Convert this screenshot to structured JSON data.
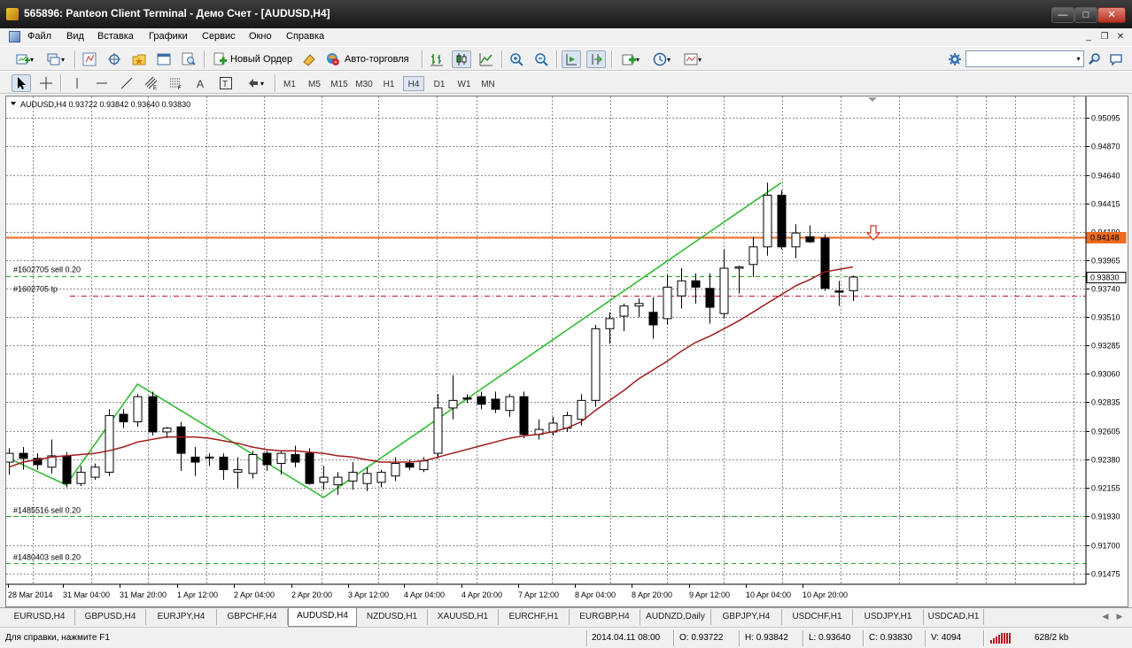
{
  "window": {
    "title": "565896: Panteon Client Terminal - Демо Счет - [AUDUSD,H4]",
    "minimize": "0",
    "maximize": "1",
    "close": "r"
  },
  "menu": {
    "items": [
      "Файл",
      "Вид",
      "Вставка",
      "Графики",
      "Сервис",
      "Окно",
      "Справка"
    ],
    "mdi": [
      "_",
      "❐",
      "✕"
    ]
  },
  "toolbar": {
    "new_order": "Новый Ордер",
    "auto_trading": "Авто-торговля",
    "timeframes": [
      "M1",
      "M5",
      "M15",
      "M30",
      "H1",
      "H4",
      "D1",
      "W1",
      "MN"
    ],
    "active_timeframe": "H4"
  },
  "chart": {
    "header": "AUDUSD,H4  0.93722 0.93842 0.93640 0.93830",
    "colors": {
      "bull_fill": "#ffffff",
      "bear_fill": "#000000",
      "ma": "#a01c1c",
      "zigzag": "#33bb33",
      "price_line": "#ee6a1f",
      "order_line": "#22a822",
      "tp_line": "#c8102e"
    },
    "order_labels": {
      "sell1": "#1602705 sell 0.20",
      "tp1": "#1602705 tp",
      "sell2": "#1485516 sell 0.20",
      "sell3": "#1480403 sell 0.20"
    },
    "price_tags": {
      "current": "0.94148",
      "bid": "0.93830"
    }
  },
  "chart_data": {
    "type": "candlestick",
    "symbol": "AUDUSD",
    "timeframe": "H4",
    "y_ticks": [
      "0.95095",
      "0.94870",
      "0.94640",
      "0.94415",
      "0.94190",
      "0.93965",
      "0.93740",
      "0.93510",
      "0.93285",
      "0.93060",
      "0.92835",
      "0.92605",
      "0.92380",
      "0.92155",
      "0.91930",
      "0.91700",
      "0.91475"
    ],
    "x_ticks": [
      "28 Mar 2014",
      "31 Mar 04:00",
      "31 Mar 20:00",
      "1 Apr 12:00",
      "2 Apr 04:00",
      "2 Apr 20:00",
      "3 Apr 12:00",
      "4 Apr 04:00",
      "4 Apr 20:00",
      "7 Apr 12:00",
      "8 Apr 04:00",
      "8 Apr 20:00",
      "9 Apr 12:00",
      "10 Apr 04:00",
      "10 Apr 20:00"
    ],
    "ylim": [
      0.9139,
      0.9525
    ],
    "candles": [
      [
        0.9236,
        0.9247,
        0.9226,
        0.9243
      ],
      [
        0.9243,
        0.9248,
        0.923,
        0.9239
      ],
      [
        0.9239,
        0.9243,
        0.923,
        0.9234
      ],
      [
        0.9232,
        0.9254,
        0.9227,
        0.9241
      ],
      [
        0.9241,
        0.9244,
        0.9216,
        0.9219
      ],
      [
        0.9219,
        0.9233,
        0.9217,
        0.9228
      ],
      [
        0.9224,
        0.9235,
        0.9222,
        0.9232
      ],
      [
        0.9228,
        0.9278,
        0.9225,
        0.9273
      ],
      [
        0.9274,
        0.9278,
        0.9263,
        0.9268
      ],
      [
        0.9268,
        0.929,
        0.9264,
        0.9288
      ],
      [
        0.9288,
        0.9292,
        0.9257,
        0.926
      ],
      [
        0.926,
        0.9264,
        0.9255,
        0.9263
      ],
      [
        0.9264,
        0.9268,
        0.9229,
        0.9243
      ],
      [
        0.924,
        0.9248,
        0.9225,
        0.9236
      ],
      [
        0.924,
        0.9243,
        0.9233,
        0.924
      ],
      [
        0.924,
        0.9243,
        0.9222,
        0.923
      ],
      [
        0.9228,
        0.924,
        0.9215,
        0.923
      ],
      [
        0.9227,
        0.9245,
        0.9223,
        0.9242
      ],
      [
        0.9243,
        0.9245,
        0.9229,
        0.9234
      ],
      [
        0.9235,
        0.9245,
        0.9226,
        0.9243
      ],
      [
        0.9242,
        0.9249,
        0.9232,
        0.9236
      ],
      [
        0.9243,
        0.9247,
        0.9218,
        0.9219
      ],
      [
        0.922,
        0.9233,
        0.9214,
        0.9224
      ],
      [
        0.9218,
        0.9228,
        0.921,
        0.9224
      ],
      [
        0.9221,
        0.9236,
        0.9214,
        0.9228
      ],
      [
        0.9219,
        0.9232,
        0.9213,
        0.9227
      ],
      [
        0.922,
        0.923,
        0.9216,
        0.9228
      ],
      [
        0.9225,
        0.924,
        0.9221,
        0.9235
      ],
      [
        0.9235,
        0.9238,
        0.923,
        0.9232
      ],
      [
        0.923,
        0.924,
        0.9228,
        0.9237
      ],
      [
        0.9243,
        0.929,
        0.9239,
        0.9279
      ],
      [
        0.9279,
        0.9305,
        0.927,
        0.9285
      ],
      [
        0.9287,
        0.929,
        0.9283,
        0.9286
      ],
      [
        0.9288,
        0.9292,
        0.9278,
        0.9282
      ],
      [
        0.9286,
        0.9292,
        0.9275,
        0.9278
      ],
      [
        0.9277,
        0.929,
        0.9272,
        0.9288
      ],
      [
        0.9288,
        0.9292,
        0.9255,
        0.9258
      ],
      [
        0.9258,
        0.927,
        0.9254,
        0.9262
      ],
      [
        0.926,
        0.9272,
        0.9257,
        0.9267
      ],
      [
        0.9263,
        0.9276,
        0.926,
        0.9273
      ],
      [
        0.927,
        0.929,
        0.9265,
        0.9285
      ],
      [
        0.9285,
        0.9345,
        0.928,
        0.9342
      ],
      [
        0.9342,
        0.9355,
        0.933,
        0.935
      ],
      [
        0.9352,
        0.9362,
        0.934,
        0.936
      ],
      [
        0.936,
        0.9366,
        0.9351,
        0.9362
      ],
      [
        0.9355,
        0.9367,
        0.9334,
        0.9345
      ],
      [
        0.935,
        0.9385,
        0.9345,
        0.9375
      ],
      [
        0.9368,
        0.939,
        0.9358,
        0.938
      ],
      [
        0.938,
        0.9386,
        0.9362,
        0.9375
      ],
      [
        0.9374,
        0.9386,
        0.9346,
        0.9359
      ],
      [
        0.9354,
        0.9405,
        0.935,
        0.939
      ],
      [
        0.939,
        0.9392,
        0.937,
        0.9391
      ],
      [
        0.9393,
        0.9415,
        0.9383,
        0.9407
      ],
      [
        0.9407,
        0.9458,
        0.94,
        0.9448
      ],
      [
        0.9448,
        0.9452,
        0.9405,
        0.9407
      ],
      [
        0.9407,
        0.9425,
        0.9398,
        0.9418
      ],
      [
        0.9415,
        0.9424,
        0.941,
        0.9411
      ],
      [
        0.9414,
        0.9417,
        0.9372,
        0.9374
      ],
      [
        0.9372,
        0.938,
        0.936,
        0.9371
      ],
      [
        0.93722,
        0.93842,
        0.9364,
        0.9383
      ]
    ],
    "ma_series": [
      0.9232,
      0.9236,
      0.9238,
      0.924,
      0.9241,
      0.9242,
      0.9243,
      0.9245,
      0.9248,
      0.9252,
      0.9254,
      0.9256,
      0.9256,
      0.9256,
      0.9255,
      0.9253,
      0.9251,
      0.9248,
      0.9246,
      0.9245,
      0.9245,
      0.9244,
      0.9243,
      0.9241,
      0.924,
      0.9238,
      0.9236,
      0.9236,
      0.9236,
      0.9237,
      0.924,
      0.9243,
      0.9246,
      0.9249,
      0.9252,
      0.9255,
      0.9257,
      0.9258,
      0.926,
      0.9263,
      0.9268,
      0.9277,
      0.9285,
      0.9293,
      0.9302,
      0.9309,
      0.9316,
      0.9324,
      0.9331,
      0.9336,
      0.9342,
      0.9348,
      0.9355,
      0.9362,
      0.9369,
      0.9376,
      0.9381,
      0.9387,
      0.9389,
      0.9391
    ],
    "zigzag": [
      [
        0,
        0.9239
      ],
      [
        4,
        0.9218
      ],
      [
        9,
        0.9298
      ],
      [
        22,
        0.9208
      ],
      [
        54,
        0.9458
      ]
    ],
    "horizontal_lines": {
      "current_price": 0.94148,
      "sell_1602705": 0.9384,
      "tp_1602705": 0.9368,
      "sell_1485516": 0.9193,
      "sell_1480403": 0.9156
    }
  },
  "tabs": [
    "EURUSD,H4",
    "GBPUSD,H4",
    "EURJPY,H4",
    "GBPCHF,H4",
    "AUDUSD,H4",
    "NZDUSD,H1",
    "XAUUSD,H1",
    "EURCHF,H1",
    "EURGBP,H4",
    "AUDNZD,Daily",
    "GBPJPY,H4",
    "USDCHF,H1",
    "USDJPY,H1",
    "USDCAD,H1"
  ],
  "active_tab": "AUDUSD,H4",
  "status": {
    "help": "Для справки, нажмите F1",
    "datetime": "2014.04.11 08:00",
    "open": "O: 0.93722",
    "high": "H: 0.93842",
    "low": "L: 0.93640",
    "close": "C: 0.93830",
    "volume": "V: 4094",
    "traffic": "628/2 kb"
  }
}
